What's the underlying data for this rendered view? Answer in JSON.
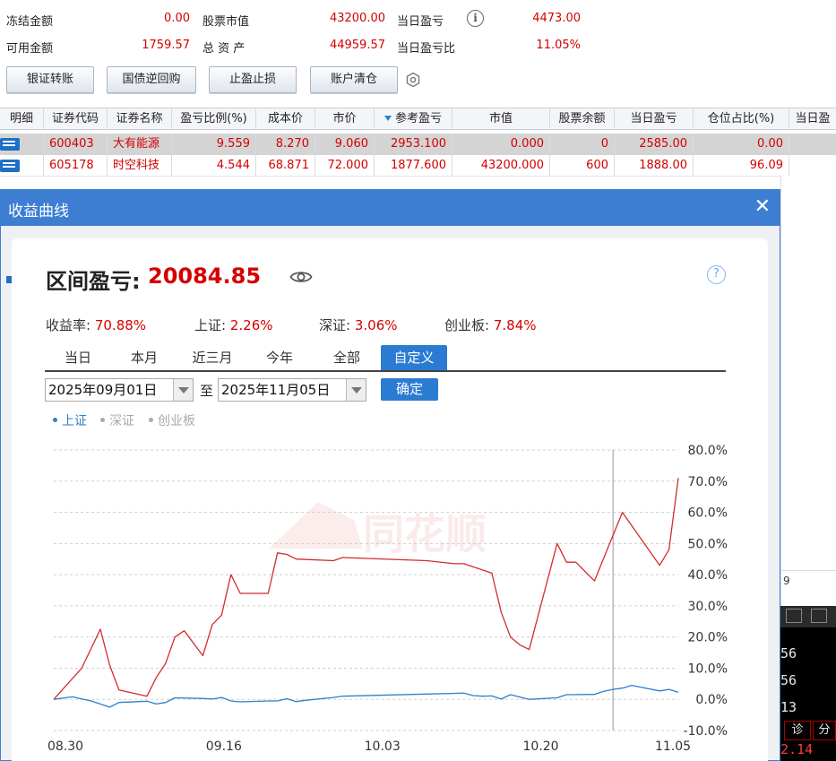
{
  "summary": {
    "frozen_label": "冻结金额",
    "frozen_value": "0.00",
    "available_label": "可用金额",
    "available_value": "1759.57",
    "market_value_label": "股票市值",
    "market_value_value": "43200.00",
    "total_assets_label": "总 资 产",
    "total_assets_value": "44959.57",
    "day_pl_label": "当日盈亏",
    "day_pl_value": "4473.00",
    "day_pl_ratio_label": "当日盈亏比",
    "day_pl_ratio_value": "11.05%",
    "info_icon": "info-icon"
  },
  "toolbar": {
    "buttons": [
      "银证转账",
      "国债逆回购",
      "止盈止损",
      "账户清仓"
    ],
    "settings_icon": "settings-hex-icon"
  },
  "positions": {
    "headers": [
      "明细",
      "证券代码",
      "证券名称",
      "盈亏比例(%)",
      "成本价",
      "市价",
      "参考盈亏",
      "市值",
      "股票余额",
      "当日盈亏",
      "仓位占比(%)",
      "当日盈"
    ],
    "rows": [
      {
        "code": "600403",
        "name": "大有能源",
        "pl_ratio": "9.559",
        "cost": "8.270",
        "price": "9.060",
        "ref_pl": "2953.100",
        "mv": "0.000",
        "balance": "0",
        "day_pl": "2585.00",
        "position_pct": "0.00"
      },
      {
        "code": "605178",
        "name": "时空科技",
        "pl_ratio": "4.544",
        "cost": "68.871",
        "price": "72.000",
        "ref_pl": "1877.600",
        "mv": "43200.000",
        "balance": "600",
        "day_pl": "1888.00",
        "position_pct": "96.09"
      }
    ]
  },
  "side": {
    "strip_text": "9",
    "tab_diag": "诊",
    "tab_fen": "分",
    "num1": "56",
    "num2": "56",
    "num3": "13",
    "red_num": "2.14"
  },
  "dialog": {
    "title": "收益曲线",
    "close_label": "✕",
    "pl_label": "区间盈亏:",
    "pl_value": "20084.85",
    "help_label": "?",
    "stats": [
      {
        "k": "收益率:",
        "v": "70.88%"
      },
      {
        "k": "上证:",
        "v": "2.26%"
      },
      {
        "k": "深证:",
        "v": "3.06%"
      },
      {
        "k": "创业板:",
        "v": "7.84%"
      }
    ],
    "tabs": [
      "当日",
      "本月",
      "近三月",
      "今年",
      "全部",
      "自定义"
    ],
    "active_tab": "自定义",
    "date_from": "2025年09月01日",
    "to_label": "至",
    "date_to": "2025年11月05日",
    "confirm_label": "确定",
    "legend": [
      {
        "name": "上证",
        "color": "#2f7fc9"
      },
      {
        "name": "深证",
        "color": "#aaaaaa"
      },
      {
        "name": "创业板",
        "color": "#aaaaaa"
      }
    ],
    "watermark": "同花顺"
  },
  "colors": {
    "accent": "#2b7bd3",
    "loss_red": "#d40000",
    "title_bar": "#3d7ed2"
  },
  "chart_data": {
    "type": "line",
    "x_tick_labels": [
      "08.30",
      "09.16",
      "10.03",
      "10.20",
      "11.05"
    ],
    "x_ticks": [
      "2025-08-30",
      "2025-09-16",
      "2025-10-03",
      "2025-10-20",
      "2025-11-05"
    ],
    "ylim": [
      -10,
      80
    ],
    "y_ticks": [
      "80.0%",
      "70.0%",
      "60.0%",
      "50.0%",
      "40.0%",
      "30.0%",
      "20.0%",
      "10.0%",
      "0.0%",
      "-10.0%"
    ],
    "y_tick_values": [
      80,
      70,
      60,
      50,
      40,
      30,
      20,
      10,
      0,
      -10
    ],
    "grid": true,
    "series": [
      {
        "color": "#d42b2b",
        "x": [
          "2025-08-30",
          "2025-09-02",
          "2025-09-04",
          "2025-09-05",
          "2025-09-06",
          "2025-09-09",
          "2025-09-10",
          "2025-09-11",
          "2025-09-12",
          "2025-09-13",
          "2025-09-15",
          "2025-09-16",
          "2025-09-17",
          "2025-09-18",
          "2025-09-19",
          "2025-09-22",
          "2025-09-23",
          "2025-09-24",
          "2025-09-25",
          "2025-09-29",
          "2025-09-30",
          "2025-10-09",
          "2025-10-12",
          "2025-10-13",
          "2025-10-16",
          "2025-10-17",
          "2025-10-18",
          "2025-10-19",
          "2025-10-20",
          "2025-10-23",
          "2025-10-24",
          "2025-10-25",
          "2025-10-27",
          "2025-10-30",
          "2025-11-03",
          "2025-11-04",
          "2025-11-05"
        ],
        "values": [
          0.0,
          10.0,
          22.5,
          11.0,
          3.0,
          1.0,
          7.0,
          11.5,
          20.0,
          22.0,
          14.0,
          24.0,
          27.0,
          40.0,
          34.0,
          34.0,
          47.0,
          46.5,
          45.0,
          44.5,
          45.5,
          44.5,
          43.5,
          43.5,
          40.5,
          28.0,
          20.0,
          17.5,
          16.0,
          50.0,
          44.0,
          44.0,
          38.0,
          60.0,
          43.0,
          48.0,
          71.0
        ]
      },
      {
        "name": "上证",
        "color": "#2f7fc9",
        "x": [
          "2025-08-30",
          "2025-09-01",
          "2025-09-03",
          "2025-09-05",
          "2025-09-06",
          "2025-09-09",
          "2025-09-10",
          "2025-09-11",
          "2025-09-12",
          "2025-09-15",
          "2025-09-16",
          "2025-09-17",
          "2025-09-18",
          "2025-09-19",
          "2025-09-22",
          "2025-09-23",
          "2025-09-24",
          "2025-09-25",
          "2025-09-26",
          "2025-09-29",
          "2025-09-30",
          "2025-10-09",
          "2025-10-13",
          "2025-10-14",
          "2025-10-15",
          "2025-10-16",
          "2025-10-17",
          "2025-10-18",
          "2025-10-20",
          "2025-10-23",
          "2025-10-24",
          "2025-10-27",
          "2025-10-28",
          "2025-10-29",
          "2025-10-30",
          "2025-10-31",
          "2025-11-03",
          "2025-11-04",
          "2025-11-05"
        ],
        "values": [
          0.0,
          0.8,
          -0.5,
          -2.5,
          -1.0,
          -0.6,
          -1.5,
          -1.0,
          0.5,
          0.3,
          0.1,
          0.6,
          -0.5,
          -0.8,
          -0.5,
          -0.5,
          0.2,
          -0.7,
          -0.3,
          0.6,
          1.0,
          1.7,
          2.0,
          1.2,
          1.0,
          1.1,
          0.1,
          1.5,
          0.0,
          0.5,
          1.5,
          1.6,
          2.6,
          3.2,
          3.6,
          4.5,
          2.7,
          3.2,
          2.3
        ]
      }
    ],
    "crosshair_x": "2025-10-29"
  }
}
